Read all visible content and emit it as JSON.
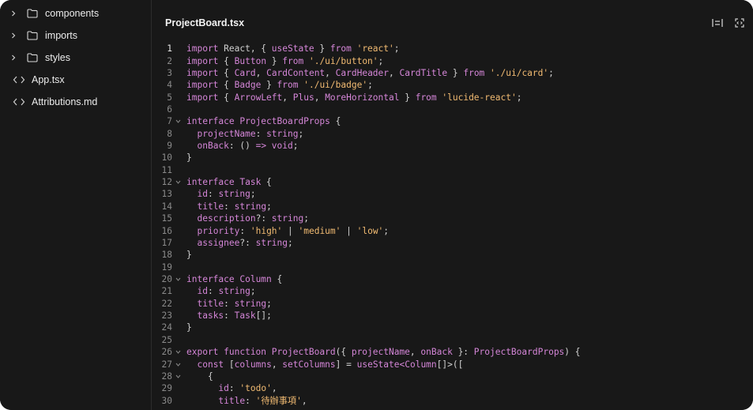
{
  "sidebar": {
    "items": [
      {
        "label": "components",
        "type": "folder",
        "icon": "folder-icon"
      },
      {
        "label": "imports",
        "type": "folder",
        "icon": "folder-icon"
      },
      {
        "label": "styles",
        "type": "folder",
        "icon": "folder-icon"
      },
      {
        "label": "App.tsx",
        "type": "file",
        "icon": "code-file-icon"
      },
      {
        "label": "Attributions.md",
        "type": "file",
        "icon": "code-file-icon"
      }
    ]
  },
  "editor": {
    "filename": "ProjectBoard.tsx",
    "toolbar": [
      "wrap-lines-icon",
      "code-expand-icon"
    ],
    "lines": [
      {
        "n": "1",
        "active": true,
        "fold": false,
        "tokens": [
          [
            "k",
            "import "
          ],
          [
            "p",
            "React, { "
          ],
          [
            "k",
            "useState"
          ],
          [
            "p",
            " } "
          ],
          [
            "k",
            "from "
          ],
          [
            "s",
            "'react'"
          ],
          [
            "p",
            ";"
          ]
        ]
      },
      {
        "n": "2",
        "fold": false,
        "tokens": [
          [
            "k",
            "import "
          ],
          [
            "p",
            "{ "
          ],
          [
            "k",
            "Button"
          ],
          [
            "p",
            " } "
          ],
          [
            "k",
            "from "
          ],
          [
            "s",
            "'./ui/button'"
          ],
          [
            "p",
            ";"
          ]
        ]
      },
      {
        "n": "3",
        "fold": false,
        "tokens": [
          [
            "k",
            "import "
          ],
          [
            "p",
            "{ "
          ],
          [
            "k",
            "Card"
          ],
          [
            "p",
            ", "
          ],
          [
            "k",
            "CardContent"
          ],
          [
            "p",
            ", "
          ],
          [
            "k",
            "CardHeader"
          ],
          [
            "p",
            ", "
          ],
          [
            "k",
            "CardTitle"
          ],
          [
            "p",
            " } "
          ],
          [
            "k",
            "from "
          ],
          [
            "s",
            "'./ui/card'"
          ],
          [
            "p",
            ";"
          ]
        ]
      },
      {
        "n": "4",
        "fold": false,
        "tokens": [
          [
            "k",
            "import "
          ],
          [
            "p",
            "{ "
          ],
          [
            "k",
            "Badge"
          ],
          [
            "p",
            " } "
          ],
          [
            "k",
            "from "
          ],
          [
            "s",
            "'./ui/badge'"
          ],
          [
            "p",
            ";"
          ]
        ]
      },
      {
        "n": "5",
        "fold": false,
        "tokens": [
          [
            "k",
            "import "
          ],
          [
            "p",
            "{ "
          ],
          [
            "k",
            "ArrowLeft"
          ],
          [
            "p",
            ", "
          ],
          [
            "k",
            "Plus"
          ],
          [
            "p",
            ", "
          ],
          [
            "k",
            "MoreHorizontal"
          ],
          [
            "p",
            " } "
          ],
          [
            "k",
            "from "
          ],
          [
            "s",
            "'lucide-react'"
          ],
          [
            "p",
            ";"
          ]
        ]
      },
      {
        "n": "6",
        "fold": false,
        "tokens": []
      },
      {
        "n": "7",
        "fold": true,
        "tokens": [
          [
            "k",
            "interface "
          ],
          [
            "k",
            "ProjectBoardProps"
          ],
          [
            "p",
            " {"
          ]
        ]
      },
      {
        "n": "8",
        "fold": false,
        "tokens": [
          [
            "p",
            "  "
          ],
          [
            "k",
            "projectName"
          ],
          [
            "p",
            ": "
          ],
          [
            "k",
            "string"
          ],
          [
            "p",
            ";"
          ]
        ]
      },
      {
        "n": "9",
        "fold": false,
        "tokens": [
          [
            "p",
            "  "
          ],
          [
            "k",
            "onBack"
          ],
          [
            "p",
            ": () "
          ],
          [
            "k",
            "=> void"
          ],
          [
            "p",
            ";"
          ]
        ]
      },
      {
        "n": "10",
        "fold": false,
        "tokens": [
          [
            "p",
            "}"
          ]
        ]
      },
      {
        "n": "11",
        "fold": false,
        "tokens": []
      },
      {
        "n": "12",
        "fold": true,
        "tokens": [
          [
            "k",
            "interface "
          ],
          [
            "k",
            "Task"
          ],
          [
            "p",
            " {"
          ]
        ]
      },
      {
        "n": "13",
        "fold": false,
        "tokens": [
          [
            "p",
            "  "
          ],
          [
            "k",
            "id"
          ],
          [
            "p",
            ": "
          ],
          [
            "k",
            "string"
          ],
          [
            "p",
            ";"
          ]
        ]
      },
      {
        "n": "14",
        "fold": false,
        "tokens": [
          [
            "p",
            "  "
          ],
          [
            "k",
            "title"
          ],
          [
            "p",
            ": "
          ],
          [
            "k",
            "string"
          ],
          [
            "p",
            ";"
          ]
        ]
      },
      {
        "n": "15",
        "fold": false,
        "tokens": [
          [
            "p",
            "  "
          ],
          [
            "k",
            "description"
          ],
          [
            "p",
            "?: "
          ],
          [
            "k",
            "string"
          ],
          [
            "p",
            ";"
          ]
        ]
      },
      {
        "n": "16",
        "fold": false,
        "tokens": [
          [
            "p",
            "  "
          ],
          [
            "k",
            "priority"
          ],
          [
            "p",
            ": "
          ],
          [
            "s",
            "'high'"
          ],
          [
            "p",
            " | "
          ],
          [
            "s",
            "'medium'"
          ],
          [
            "p",
            " | "
          ],
          [
            "s",
            "'low'"
          ],
          [
            "p",
            ";"
          ]
        ]
      },
      {
        "n": "17",
        "fold": false,
        "tokens": [
          [
            "p",
            "  "
          ],
          [
            "k",
            "assignee"
          ],
          [
            "p",
            "?: "
          ],
          [
            "k",
            "string"
          ],
          [
            "p",
            ";"
          ]
        ]
      },
      {
        "n": "18",
        "fold": false,
        "tokens": [
          [
            "p",
            "}"
          ]
        ]
      },
      {
        "n": "19",
        "fold": false,
        "tokens": []
      },
      {
        "n": "20",
        "fold": true,
        "tokens": [
          [
            "k",
            "interface "
          ],
          [
            "k",
            "Column"
          ],
          [
            "p",
            " {"
          ]
        ]
      },
      {
        "n": "21",
        "fold": false,
        "tokens": [
          [
            "p",
            "  "
          ],
          [
            "k",
            "id"
          ],
          [
            "p",
            ": "
          ],
          [
            "k",
            "string"
          ],
          [
            "p",
            ";"
          ]
        ]
      },
      {
        "n": "22",
        "fold": false,
        "tokens": [
          [
            "p",
            "  "
          ],
          [
            "k",
            "title"
          ],
          [
            "p",
            ": "
          ],
          [
            "k",
            "string"
          ],
          [
            "p",
            ";"
          ]
        ]
      },
      {
        "n": "23",
        "fold": false,
        "tokens": [
          [
            "p",
            "  "
          ],
          [
            "k",
            "tasks"
          ],
          [
            "p",
            ": "
          ],
          [
            "k",
            "Task"
          ],
          [
            "p",
            "[];"
          ]
        ]
      },
      {
        "n": "24",
        "fold": false,
        "tokens": [
          [
            "p",
            "}"
          ]
        ]
      },
      {
        "n": "25",
        "fold": false,
        "tokens": []
      },
      {
        "n": "26",
        "fold": true,
        "tokens": [
          [
            "k",
            "export function "
          ],
          [
            "k",
            "ProjectBoard"
          ],
          [
            "p",
            "({ "
          ],
          [
            "k",
            "projectName"
          ],
          [
            "p",
            ", "
          ],
          [
            "k",
            "onBack"
          ],
          [
            "p",
            " }: "
          ],
          [
            "k",
            "ProjectBoardProps"
          ],
          [
            "p",
            ") {"
          ]
        ]
      },
      {
        "n": "27",
        "fold": true,
        "tokens": [
          [
            "p",
            "  "
          ],
          [
            "k",
            "const "
          ],
          [
            "p",
            "["
          ],
          [
            "k",
            "columns"
          ],
          [
            "p",
            ", "
          ],
          [
            "k",
            "setColumns"
          ],
          [
            "p",
            "] = "
          ],
          [
            "k",
            "useState"
          ],
          [
            "k",
            "<Column"
          ],
          [
            "p",
            "[]>(["
          ]
        ]
      },
      {
        "n": "28",
        "fold": true,
        "tokens": [
          [
            "p",
            "    {"
          ]
        ]
      },
      {
        "n": "29",
        "fold": false,
        "tokens": [
          [
            "p",
            "      "
          ],
          [
            "k",
            "id"
          ],
          [
            "p",
            ": "
          ],
          [
            "s",
            "'todo'"
          ],
          [
            "p",
            ","
          ]
        ]
      },
      {
        "n": "30",
        "fold": false,
        "tokens": [
          [
            "p",
            "      "
          ],
          [
            "k",
            "title"
          ],
          [
            "p",
            ": "
          ],
          [
            "s",
            "'待辦事項'"
          ],
          [
            "p",
            ","
          ]
        ]
      }
    ]
  },
  "colors": {
    "background": "#181818",
    "keyword": "#d586d8",
    "string": "#f2bb72",
    "punctuation": "#d0d0d0"
  }
}
